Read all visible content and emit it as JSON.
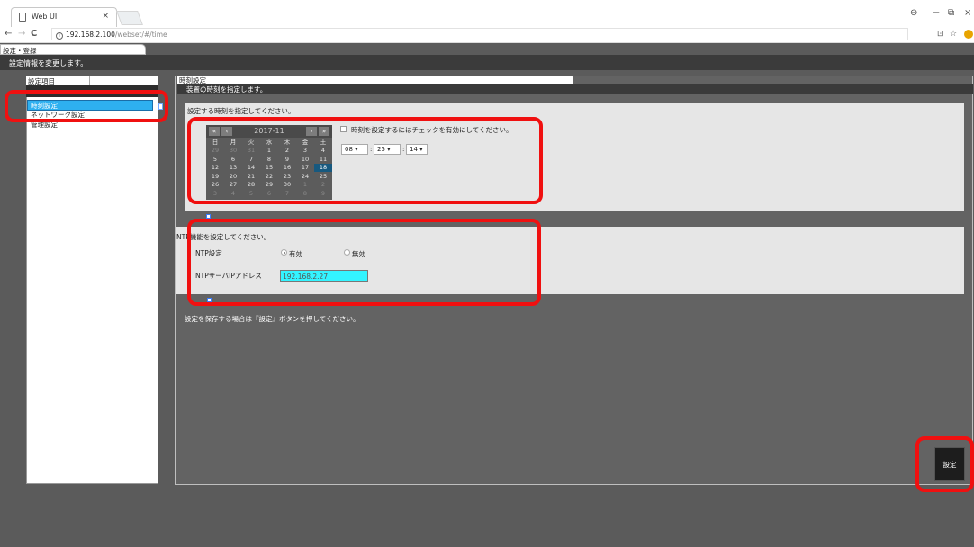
{
  "browser": {
    "tab_title": "Web UI",
    "tab_close": "×",
    "url_host": "192.168.2.100",
    "url_path": "/webset/#/time",
    "back": "←",
    "forward": "→",
    "reload": "C",
    "minimize": "−",
    "restore": "⧉",
    "close": "×",
    "profile_icon": "⊖",
    "translate_icon": "⊡",
    "star_icon": "☆"
  },
  "app": {
    "tab_label": "設定・登録",
    "header_text": "設定情報を変更します。"
  },
  "sidebar": {
    "title": "設定項目",
    "items": [
      {
        "label": "時刻設定",
        "active": true
      },
      {
        "label": "ネットワーク設定",
        "active": false
      },
      {
        "label": "管理設定",
        "active": false
      }
    ]
  },
  "main": {
    "title": "時刻設定",
    "subtitle": "装置の時刻を指定します。",
    "time_section": {
      "label": "設定する時刻を指定してください。",
      "checkbox_label": "時刻を設定するにはチェックを有効にしてください。",
      "hour": "08",
      "minute": "25",
      "second": "14",
      "colon": ":"
    },
    "calendar": {
      "month": "2017-11",
      "prev_year": "«",
      "prev_month": "‹",
      "next_month": "›",
      "next_year": "»",
      "weekdays": [
        "日",
        "月",
        "火",
        "水",
        "木",
        "金",
        "土"
      ],
      "weeks": [
        [
          "29",
          "30",
          "31",
          "1",
          "2",
          "3",
          "4"
        ],
        [
          "5",
          "6",
          "7",
          "8",
          "9",
          "10",
          "11"
        ],
        [
          "12",
          "13",
          "14",
          "15",
          "16",
          "17",
          "18"
        ],
        [
          "19",
          "20",
          "21",
          "22",
          "23",
          "24",
          "25"
        ],
        [
          "26",
          "27",
          "28",
          "29",
          "30",
          "1",
          "2"
        ],
        [
          "3",
          "4",
          "5",
          "6",
          "7",
          "8",
          "9"
        ]
      ],
      "today": "18"
    },
    "ntp_section": {
      "label": "NTP機能を設定してください。",
      "ntp_label": "NTP設定",
      "enable_label": "有効",
      "disable_label": "無効",
      "selected": "有効",
      "ip_label": "NTPサーバIPアドレス",
      "ip_value": "192.168.2.27"
    },
    "save_note": "設定を保存する場合は『設定』ボタンを押してください。",
    "set_button": "設定"
  },
  "colors": {
    "highlight": "#f01010",
    "active_menu": "#2eb0f0",
    "ip_field": "#33f4ff",
    "panel_bg": "#636363"
  }
}
